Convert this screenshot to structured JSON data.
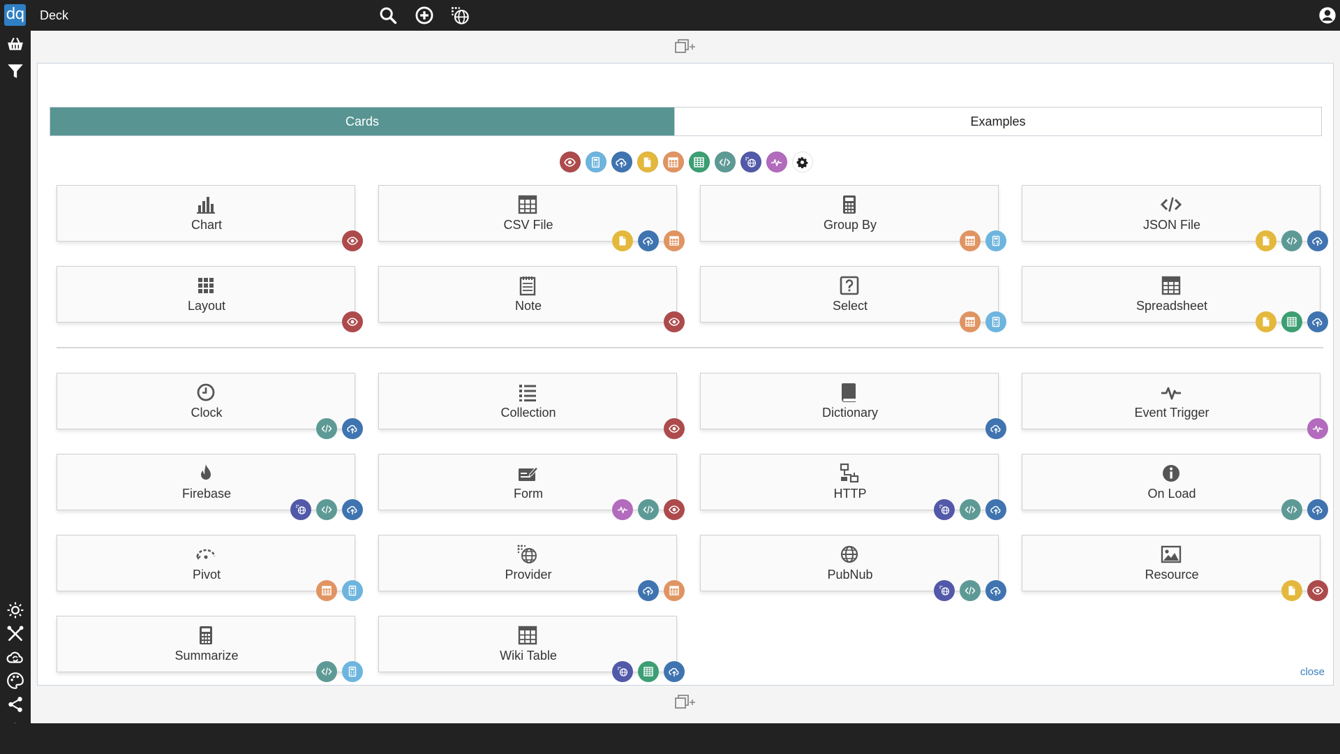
{
  "app": {
    "logo_text": "dq",
    "title": "Deck"
  },
  "topbar_icons": [
    "search-icon",
    "add-circle-icon",
    "globe-icon"
  ],
  "account_icon": "user-circle-icon",
  "sidebar": {
    "top_icons": [
      "basket-icon",
      "filter-icon"
    ],
    "bottom_icons": [
      "sun-icon",
      "tools-icon",
      "cloud-sync-icon",
      "palette-icon",
      "share-icon",
      "cloud-upload-icon"
    ]
  },
  "tabs": [
    {
      "label": "Cards",
      "active": true
    },
    {
      "label": "Examples",
      "active": false
    }
  ],
  "category_colors": {
    "view": "#ad4a4c",
    "calc": "#6db5de",
    "cloud": "#3f74b0",
    "file": "#e4b83c",
    "table": "#e09462",
    "sheet": "#3c9e73",
    "code": "#5e9a95",
    "provider": "#5259a8",
    "event": "#b26bbd"
  },
  "filter_chips": [
    "view",
    "calc",
    "cloud",
    "file",
    "table",
    "sheet",
    "code",
    "provider",
    "event"
  ],
  "settings_icon": "gear-icon",
  "section_a": [
    {
      "label": "Chart",
      "icon": "bar-chart-icon",
      "badges": [
        "view"
      ]
    },
    {
      "label": "CSV File",
      "icon": "table-grid-icon",
      "badges": [
        "file",
        "cloud",
        "table"
      ]
    },
    {
      "label": "Group By",
      "icon": "calculator-icon",
      "badges": [
        "table",
        "calc"
      ]
    },
    {
      "label": "JSON File",
      "icon": "code-icon",
      "badges": [
        "file",
        "code",
        "cloud"
      ]
    },
    {
      "label": "Layout",
      "icon": "grid-icon",
      "badges": [
        "view"
      ]
    },
    {
      "label": "Note",
      "icon": "notepad-icon",
      "badges": [
        "view"
      ]
    },
    {
      "label": "Select",
      "icon": "question-box-icon",
      "badges": [
        "table",
        "calc"
      ]
    },
    {
      "label": "Spreadsheet",
      "icon": "spreadsheet-icon",
      "badges": [
        "file",
        "sheet",
        "cloud"
      ]
    }
  ],
  "section_b": [
    {
      "label": "Clock",
      "icon": "clock-icon",
      "badges": [
        "code",
        "cloud"
      ]
    },
    {
      "label": "Collection",
      "icon": "list-icon",
      "badges": [
        "view"
      ]
    },
    {
      "label": "Dictionary",
      "icon": "book-icon",
      "badges": [
        "cloud"
      ]
    },
    {
      "label": "Event Trigger",
      "icon": "pulse-icon",
      "badges": [
        "event"
      ]
    },
    {
      "label": "Firebase",
      "icon": "flame-icon",
      "badges": [
        "provider",
        "code",
        "cloud"
      ]
    },
    {
      "label": "Form",
      "icon": "form-icon",
      "badges": [
        "event",
        "code",
        "view"
      ]
    },
    {
      "label": "HTTP",
      "icon": "network-icon",
      "badges": [
        "provider",
        "code",
        "cloud"
      ]
    },
    {
      "label": "On Load",
      "icon": "info-icon",
      "badges": [
        "code",
        "cloud"
      ]
    },
    {
      "label": "Pivot",
      "icon": "pivot-icon",
      "badges": [
        "table",
        "calc"
      ]
    },
    {
      "label": "Provider",
      "icon": "provider-globe-icon",
      "badges": [
        "cloud",
        "table"
      ]
    },
    {
      "label": "PubNub",
      "icon": "globe-icon",
      "badges": [
        "provider",
        "code",
        "cloud"
      ]
    },
    {
      "label": "Resource",
      "icon": "image-icon",
      "badges": [
        "file",
        "view"
      ]
    },
    {
      "label": "Summarize",
      "icon": "calculator-icon",
      "badges": [
        "code",
        "calc"
      ]
    },
    {
      "label": "Wiki Table",
      "icon": "table-grid-icon",
      "badges": [
        "provider",
        "sheet",
        "cloud"
      ]
    }
  ],
  "close_label": "close"
}
